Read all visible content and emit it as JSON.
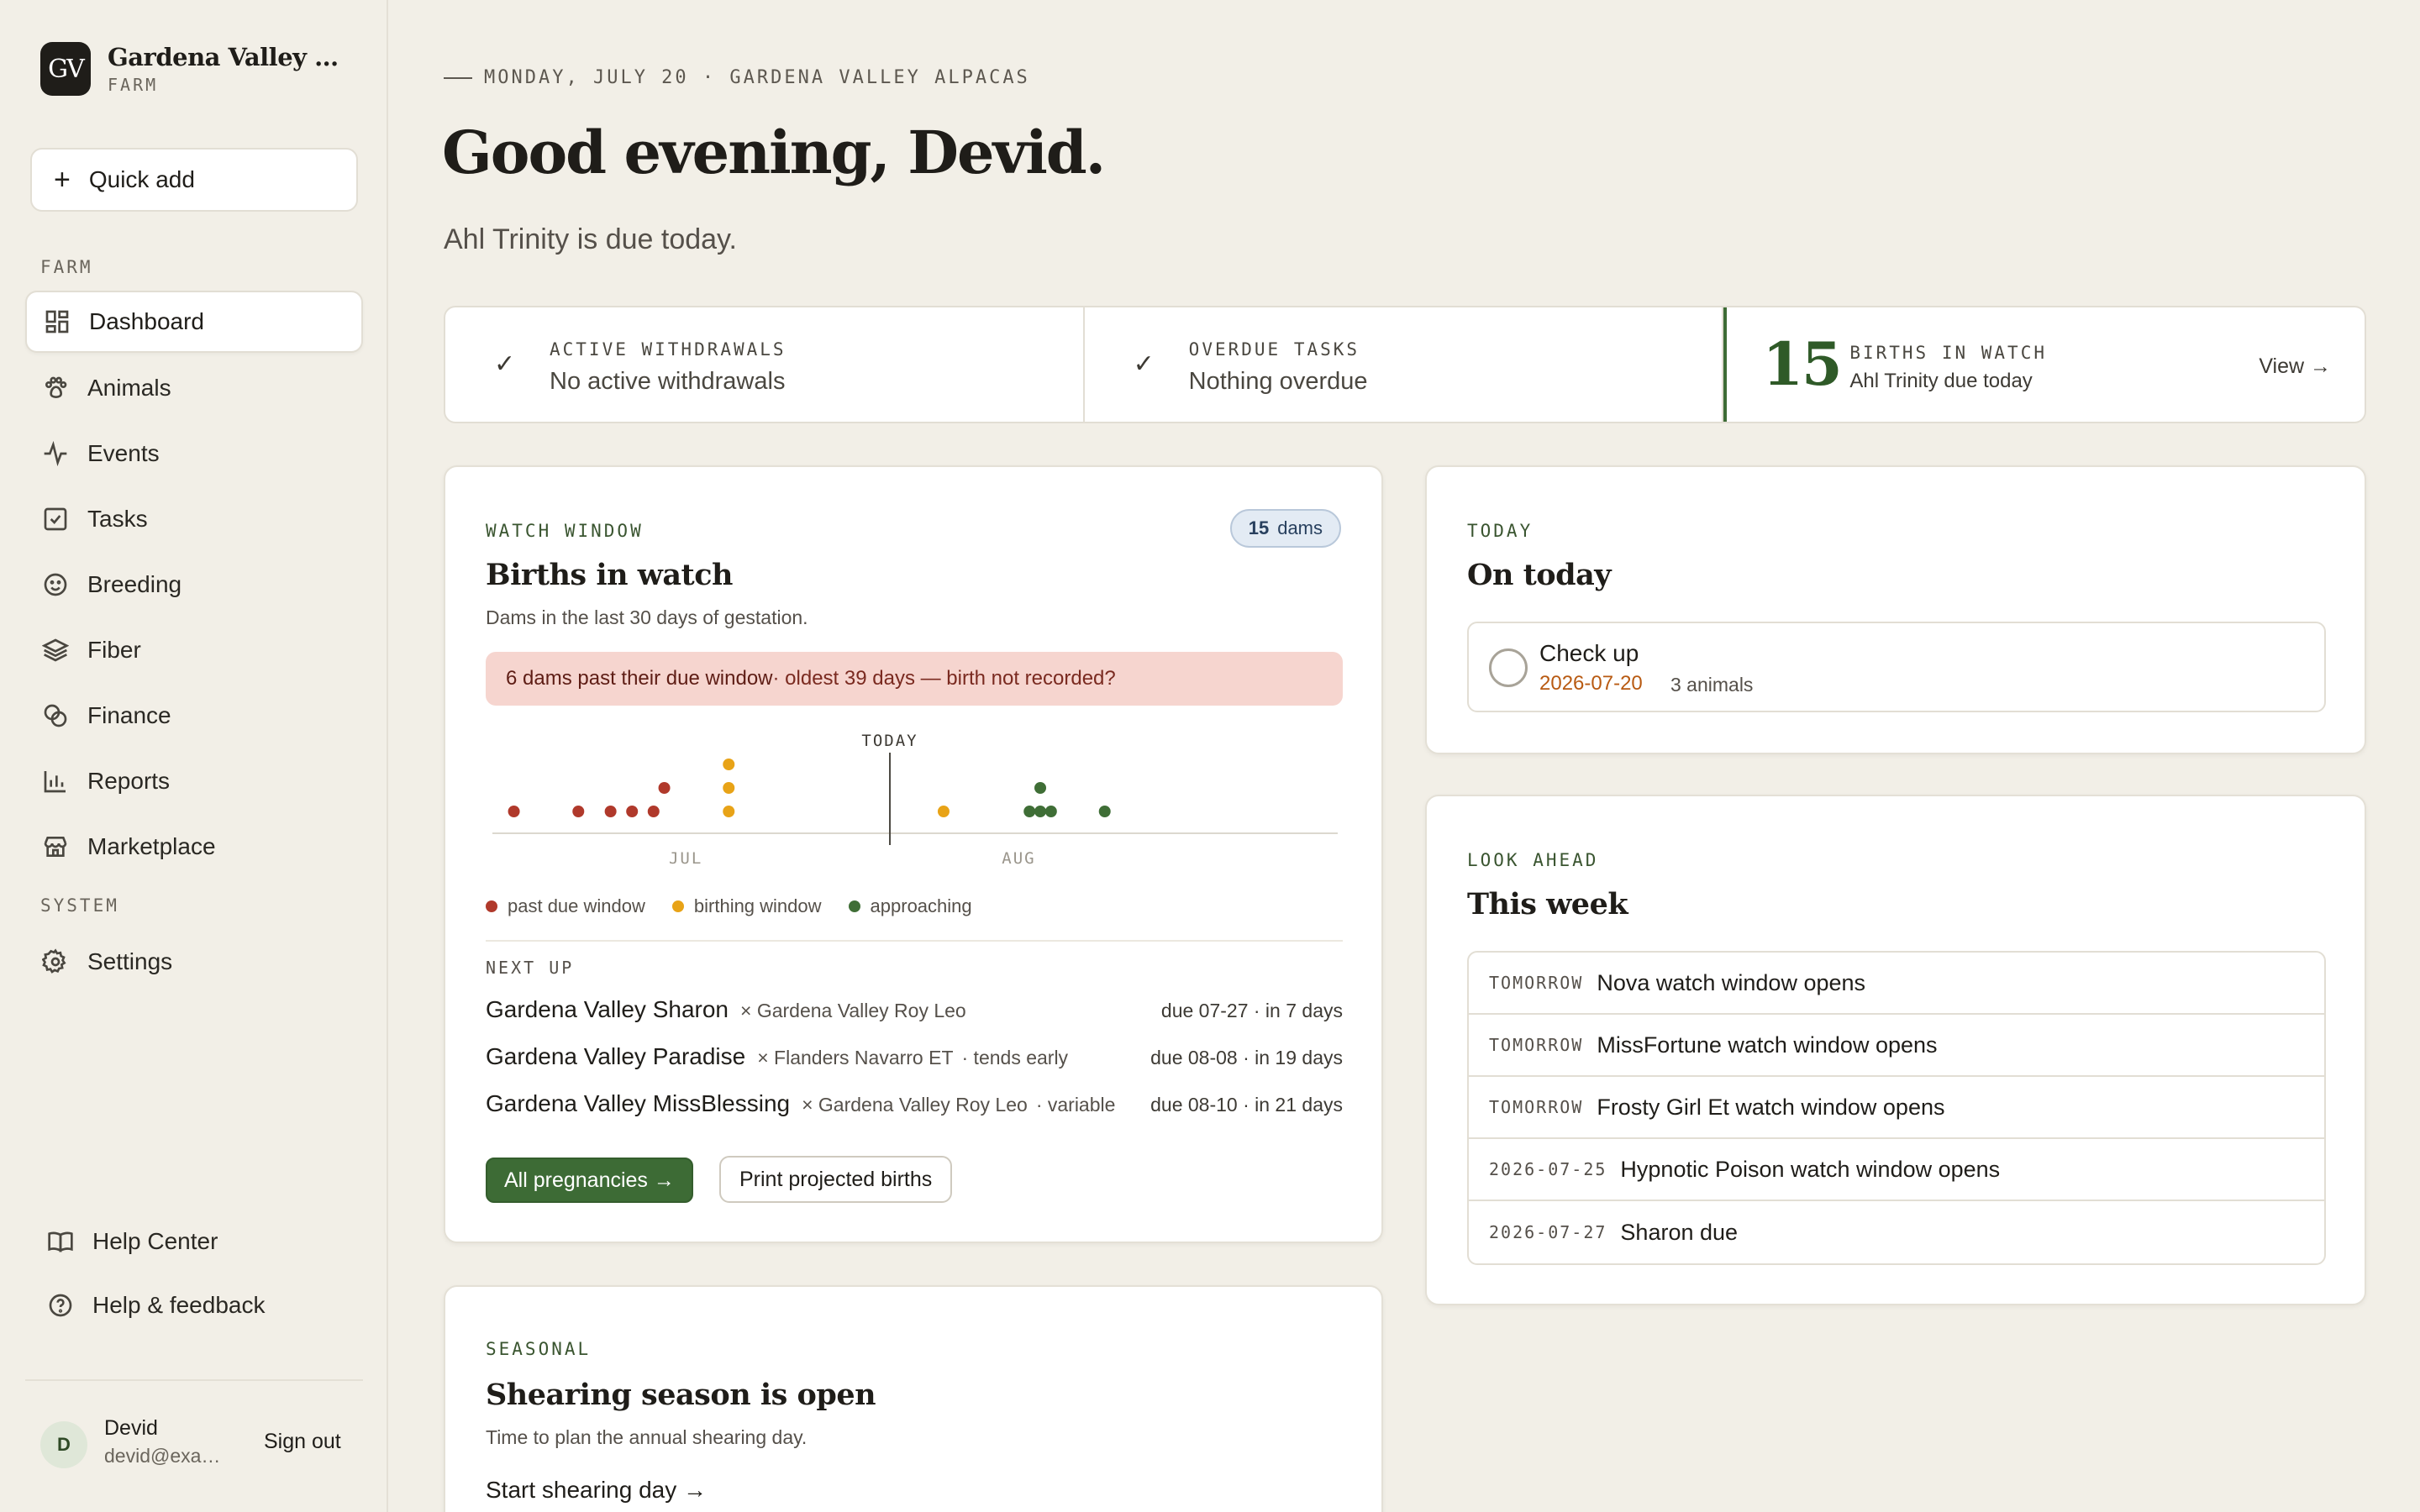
{
  "brand": {
    "initials": "GV",
    "name": "Gardena Valley Alpacas",
    "sub": "FARM"
  },
  "quick_add": {
    "label": "Quick add"
  },
  "nav": {
    "farm_section": "FARM",
    "system_section": "SYSTEM",
    "items": [
      {
        "label": "Dashboard",
        "icon": "grid-icon"
      },
      {
        "label": "Animals",
        "icon": "paw-icon"
      },
      {
        "label": "Events",
        "icon": "pulse-icon"
      },
      {
        "label": "Tasks",
        "icon": "checkbox-icon"
      },
      {
        "label": "Breeding",
        "icon": "smile-icon"
      },
      {
        "label": "Fiber",
        "icon": "layers-icon"
      },
      {
        "label": "Finance",
        "icon": "coins-icon"
      },
      {
        "label": "Reports",
        "icon": "bar-chart-icon"
      },
      {
        "label": "Marketplace",
        "icon": "store-icon"
      }
    ],
    "settings": {
      "label": "Settings",
      "icon": "gear-icon"
    }
  },
  "help": {
    "center": "Help Center",
    "feedback": "Help & feedback"
  },
  "user": {
    "initial": "D",
    "name": "Devid",
    "email": "devid@example.com",
    "sign_out": "Sign out"
  },
  "header": {
    "eyebrow": "MONDAY, JULY 20 · GARDENA VALLEY ALPACAS",
    "greeting": "Good evening, Devid.",
    "subtitle": "Ahl Trinity is due today."
  },
  "stats": {
    "withdrawals": {
      "label": "ACTIVE WITHDRAWALS",
      "value": "No active withdrawals"
    },
    "overdue": {
      "label": "OVERDUE TASKS",
      "value": "Nothing overdue"
    },
    "births": {
      "count": "15",
      "label": "BIRTHS IN WATCH",
      "value": "Ahl Trinity due today",
      "view": "View →"
    }
  },
  "births_card": {
    "eyebrow": "WATCH WINDOW",
    "title": "Births in watch",
    "subtitle": "Dams in the last 30 days of gestation.",
    "badge_count": "15",
    "badge_label": "dams",
    "alert_strong": "6 dams past their due window",
    "alert_rest": " · oldest 39 days — birth not recorded?",
    "legend": {
      "past": "past due window",
      "birthing": "birthing window",
      "approaching": "approaching"
    },
    "next_up_label": "NEXT UP",
    "next_up": [
      {
        "name": "Gardena Valley Sharon",
        "sire": "× Gardena Valley Roy Leo",
        "note": "",
        "due": "due 07-27 · in 7 days"
      },
      {
        "name": "Gardena Valley Paradise",
        "sire": "× Flanders Navarro ET",
        "note": "· tends early",
        "due": "due 08-08 · in 19 days"
      },
      {
        "name": "Gardena Valley MissBlessing",
        "sire": "× Gardena Valley Roy Leo",
        "note": "· variable",
        "due": "due 08-10 · in 21 days"
      }
    ],
    "primary_button": "All pregnancies →",
    "secondary_button": "Print projected births"
  },
  "chart_data": {
    "type": "scatter",
    "x_axis": "date",
    "ticks": [
      "JUL",
      "AUG"
    ],
    "today_label": "TODAY",
    "today": "2026-07-20",
    "xlim": [
      "2026-06-13",
      "2026-08-31"
    ],
    "colors": {
      "past": "#b0392b",
      "birthing": "#e8a317",
      "approaching": "#3f6e36"
    },
    "points": [
      {
        "date": "2026-06-15",
        "category": "past"
      },
      {
        "date": "2026-06-21",
        "category": "past"
      },
      {
        "date": "2026-06-24",
        "category": "past"
      },
      {
        "date": "2026-06-26",
        "category": "past"
      },
      {
        "date": "2026-06-28",
        "category": "past"
      },
      {
        "date": "2026-06-29",
        "category": "past"
      },
      {
        "date": "2026-07-05",
        "category": "birthing"
      },
      {
        "date": "2026-07-05",
        "category": "birthing"
      },
      {
        "date": "2026-07-05",
        "category": "birthing"
      },
      {
        "date": "2026-07-25",
        "category": "birthing"
      },
      {
        "date": "2026-08-02",
        "category": "approaching"
      },
      {
        "date": "2026-08-03",
        "category": "approaching"
      },
      {
        "date": "2026-08-03",
        "category": "approaching"
      },
      {
        "date": "2026-08-04",
        "category": "approaching"
      },
      {
        "date": "2026-08-09",
        "category": "approaching"
      }
    ]
  },
  "today_card": {
    "eyebrow": "TODAY",
    "title": "On today",
    "task": {
      "title": "Check up",
      "date": "2026-07-20",
      "count": "3 animals"
    }
  },
  "week_card": {
    "eyebrow": "LOOK AHEAD",
    "title": "This week",
    "items": [
      {
        "when": "TOMORROW",
        "what": "Nova watch window opens"
      },
      {
        "when": "TOMORROW",
        "what": "MissFortune watch window opens"
      },
      {
        "when": "TOMORROW",
        "what": "Frosty Girl Et watch window opens"
      },
      {
        "when": "2026-07-25",
        "what": "Hypnotic Poison watch window opens"
      },
      {
        "when": "2026-07-27",
        "what": "Sharon due"
      }
    ]
  },
  "season_card": {
    "eyebrow": "SEASONAL",
    "title": "Shearing season is open",
    "subtitle": "Time to plan the annual shearing day.",
    "link": "Start shearing day →"
  }
}
